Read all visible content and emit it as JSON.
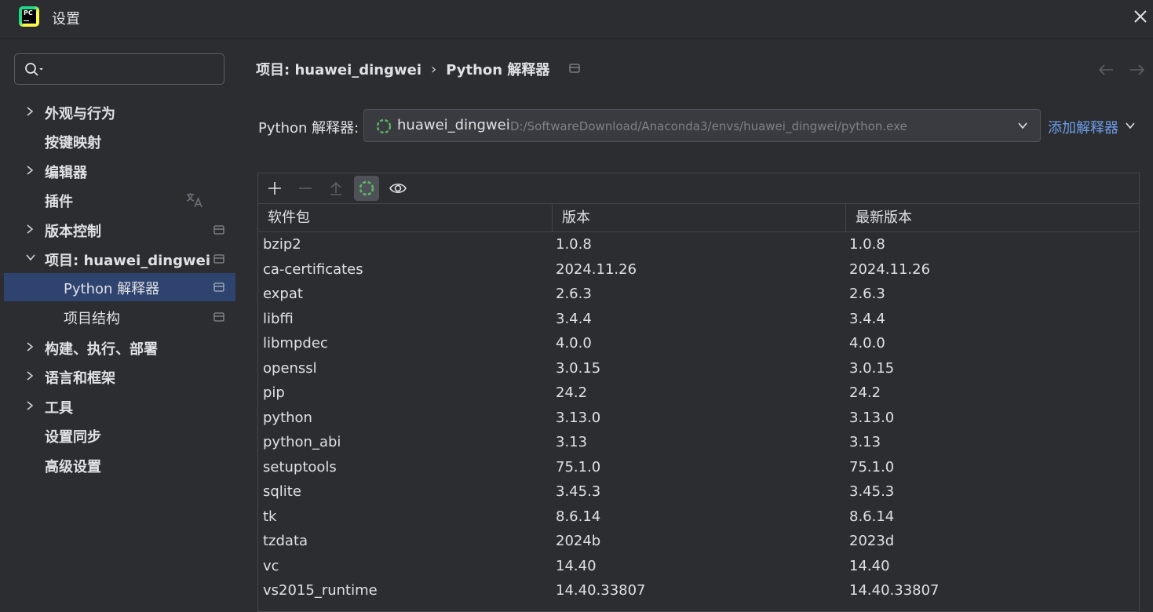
{
  "window": {
    "title": "设置"
  },
  "search": {
    "placeholder": ""
  },
  "sidebar": {
    "items": [
      {
        "label": "外观与行为"
      },
      {
        "label": "按键映射"
      },
      {
        "label": "编辑器"
      },
      {
        "label": "插件"
      },
      {
        "label": "版本控制"
      },
      {
        "label": "项目: huawei_dingwei"
      },
      {
        "label": "Python 解释器"
      },
      {
        "label": "项目结构"
      },
      {
        "label": "构建、执行、部署"
      },
      {
        "label": "语言和框架"
      },
      {
        "label": "工具"
      },
      {
        "label": "设置同步"
      },
      {
        "label": "高级设置"
      }
    ]
  },
  "breadcrumb": {
    "project": "项目: huawei_dingwei",
    "separator": "›",
    "current": "Python 解释器"
  },
  "interpreter": {
    "label": "Python 解释器:",
    "env_name": "huawei_dingwei",
    "env_path": "D:/SoftwareDownload/Anaconda3/envs/huawei_dingwei/python.exe",
    "add_label": "添加解释器"
  },
  "packages": {
    "columns": [
      "软件包",
      "版本",
      "最新版本"
    ],
    "rows": [
      [
        "bzip2",
        "1.0.8",
        "1.0.8"
      ],
      [
        "ca-certificates",
        "2024.11.26",
        "2024.11.26"
      ],
      [
        "expat",
        "2.6.3",
        "2.6.3"
      ],
      [
        "libffi",
        "3.4.4",
        "3.4.4"
      ],
      [
        "libmpdec",
        "4.0.0",
        "4.0.0"
      ],
      [
        "openssl",
        "3.0.15",
        "3.0.15"
      ],
      [
        "pip",
        "24.2",
        "24.2"
      ],
      [
        "python",
        "3.13.0",
        "3.13.0"
      ],
      [
        "python_abi",
        "3.13",
        "3.13"
      ],
      [
        "setuptools",
        "75.1.0",
        "75.1.0"
      ],
      [
        "sqlite",
        "3.45.3",
        "3.45.3"
      ],
      [
        "tk",
        "8.6.14",
        "8.6.14"
      ],
      [
        "tzdata",
        "2024b",
        "2023d"
      ],
      [
        "vc",
        "14.40",
        "14.40"
      ],
      [
        "vs2015_runtime",
        "14.40.33807",
        "14.40.33807"
      ]
    ]
  },
  "colors": {
    "accent": "#6e9ee8",
    "selected": "#2e436e",
    "background": "#2b2d30",
    "spinner": "#5fb865"
  },
  "icons": [
    "app-logo",
    "close-icon",
    "search-icon",
    "chevron-right-icon",
    "chevron-down-icon",
    "translate-icon",
    "page-icon",
    "arrow-left-icon",
    "arrow-right-icon",
    "spinner-icon",
    "plus-icon",
    "minus-icon",
    "upgrade-icon",
    "eye-icon"
  ]
}
